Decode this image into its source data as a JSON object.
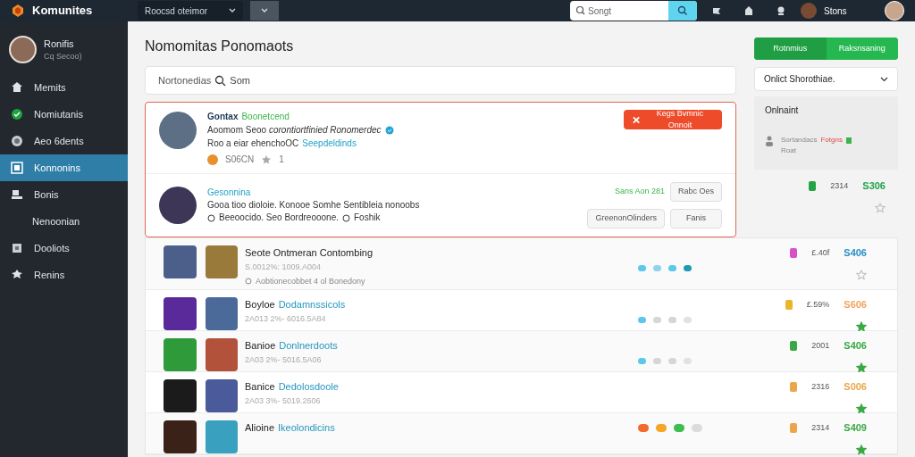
{
  "top_bar": {
    "logo": "Komunites",
    "select": "Roocsd oteimor",
    "search": {
      "placeholder": "Songt"
    },
    "user": "Stons"
  },
  "sidebar": {
    "profile": {
      "name": "Ronifis",
      "subtitle": "Cq Secoo)"
    },
    "items": [
      {
        "label": "Memits",
        "kind": "item",
        "selected": false
      },
      {
        "label": "Nomiutanis",
        "kind": "item",
        "selected": false
      },
      {
        "label": "Aeo 6dents",
        "kind": "item",
        "selected": false
      },
      {
        "label": "Konnonins",
        "kind": "item",
        "selected": true
      },
      {
        "label": "Bonis",
        "kind": "item",
        "selected": false
      },
      {
        "label": "Nenoonian",
        "kind": "subitem",
        "selected": false
      },
      {
        "label": "Dooliots",
        "kind": "item",
        "selected": false
      },
      {
        "label": "Renins",
        "kind": "item",
        "selected": false
      }
    ]
  },
  "page_title": "Nomomitas Ponomaots",
  "search": {
    "label": "Nortonedias",
    "placeholder": "Som"
  },
  "featured": [
    {
      "name": "Gontax",
      "tag": "Boonetcend",
      "line": "Aoomom Seoo *corontiortfinied Ronomerdec*",
      "verified": true,
      "detail": "Roo a eiar ehenchoOC",
      "detail_link": "Seepdeldinds",
      "meta": "S06CN",
      "stars_text": "1",
      "action": "Kegs Bvmnic Onnoit"
    },
    {
      "name": "Gesonnina",
      "description": "Gooa tioo dioloie. Konooe Somhe Sentibleia nonoobs",
      "note": "Beeoocido. Seo Bordreooone.",
      "note_link": "Foshik",
      "date": "Sans Aon 281",
      "buttons": [
        "Rabc Oes",
        "GreenonOlinders",
        "Fanis"
      ]
    }
  ],
  "right_panel": {
    "tabs": [
      {
        "label": "Rotnmius",
        "selected": true
      },
      {
        "label": "Raksnsaning",
        "selected": false
      }
    ],
    "dropdown": "Onlict Shorothiae.",
    "box_title": "Onlnaint",
    "entry": {
      "name": "Sortandacs",
      "tag": "Fotgns",
      "subtitle": "Roat"
    },
    "stat": {
      "badge": {
        "color": "#22a447"
      },
      "value": "2314",
      "price": {
        "text": "S306",
        "color": "#22a447"
      },
      "starred": false
    }
  },
  "rows": [
    {
      "title": "Seote Ontmeran Contombing",
      "title_link": "",
      "subtitle": "S.0012%: 1009.A004",
      "description": "Aobtionecobbet 4 ol Bonedony",
      "dots": [
        {
          "color": "#5bc8ec"
        },
        {
          "color": "#8fd3ef"
        },
        {
          "color": "#5bc8ec"
        },
        {
          "color": "#1f9bb5"
        }
      ],
      "badge": {
        "color": "#d94fc7"
      },
      "value": "£.40f",
      "price": {
        "text": "S406",
        "color": "#2a8fc4"
      },
      "starred": false
    },
    {
      "title": "Boyloe",
      "title_link": "Dodamnssicols",
      "subtitle": "2A013 2%- 6016.5A84",
      "dots": [
        {
          "color": "#5bc8ec"
        },
        {
          "color": "#d6d6d6"
        },
        {
          "color": "#d6d6d6"
        },
        {
          "color": "#e2e2e2"
        }
      ],
      "badge": {
        "color": "#e8b52c"
      },
      "value": "£.59%",
      "price": {
        "text": "S606",
        "color": "#f0a45c"
      },
      "starred": true
    },
    {
      "title": "Banioe",
      "title_link": "Donlnerdoots",
      "subtitle": "2A03 2%- 5016.5A06",
      "dots": [
        {
          "color": "#5bc8ec"
        },
        {
          "color": "#d6d6d6"
        },
        {
          "color": "#d6d6d6"
        },
        {
          "color": "#e2e2e2"
        }
      ],
      "badge": {
        "color": "#3aa845"
      },
      "value": "2001",
      "price": {
        "text": "S406",
        "color": "#3aa845"
      },
      "starred": true
    },
    {
      "title": "Banice",
      "title_link": "Dedolosdoole",
      "subtitle": "2A03 3%- 5019.2606",
      "dots": [],
      "badge": {
        "color": "#eba64a"
      },
      "value": "2316",
      "price": {
        "text": "S006",
        "color": "#eba64a"
      },
      "starred": true
    },
    {
      "title": "Alioine",
      "title_link": "Ikeolondicins",
      "dots": [
        {
          "color": "#f26b2a"
        },
        {
          "color": "#f5a623"
        },
        {
          "color": "#3cbf4f"
        },
        {
          "color": "#dcdcdc"
        }
      ],
      "badge": {
        "color": "#eba64a"
      },
      "value": "2314",
      "price": {
        "text": "S409",
        "color": "#3aa845"
      },
      "starred": true
    }
  ]
}
